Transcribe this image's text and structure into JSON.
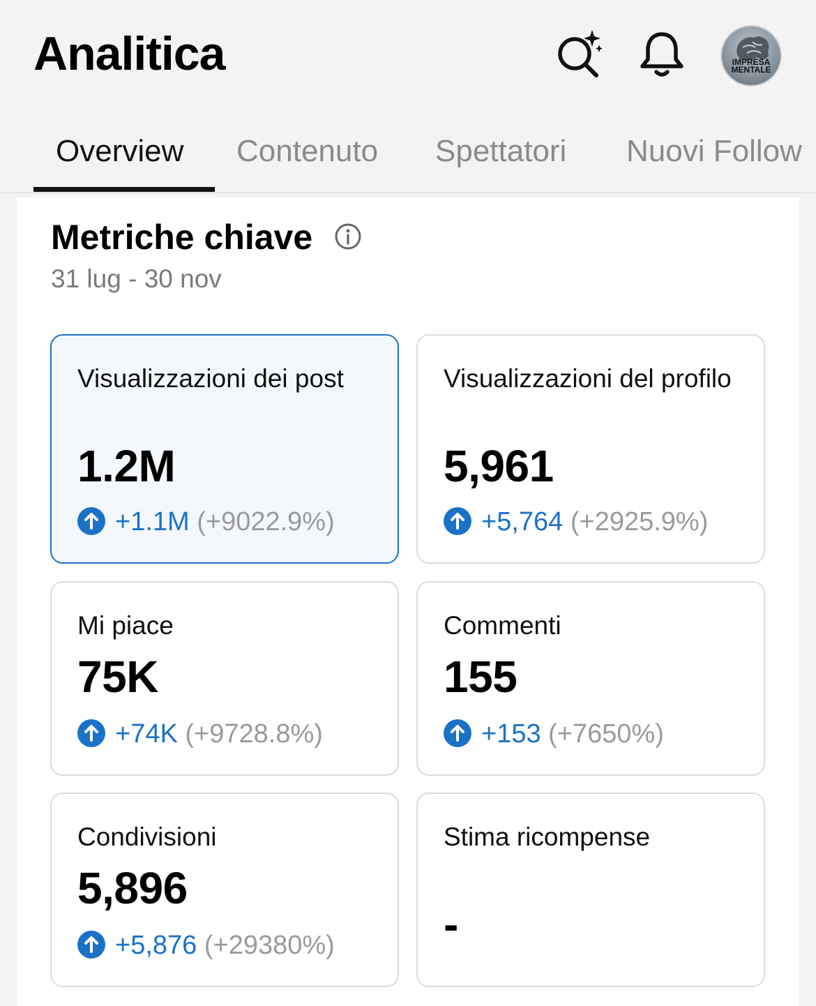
{
  "header": {
    "title": "Analitica",
    "avatar_text_line1": "IMPRESA",
    "avatar_text_line2": "MENTALE"
  },
  "tabs": [
    {
      "label": "Overview",
      "active": true
    },
    {
      "label": "Contenuto",
      "active": false
    },
    {
      "label": "Spettatori",
      "active": false
    },
    {
      "label": "Nuovi Follow",
      "active": false
    }
  ],
  "section": {
    "title": "Metriche chiave",
    "date_range": "31 lug - 30 nov"
  },
  "metrics": [
    {
      "label": "Visualizzazioni dei post",
      "value": "1.2M",
      "delta": "+1.1M",
      "pct": "(+9022.9%)",
      "selected": true
    },
    {
      "label": "Visualizzazioni del profilo",
      "value": "5,961",
      "delta": "+5,764",
      "pct": "(+2925.9%)",
      "selected": false
    },
    {
      "label": "Mi piace",
      "value": "75K",
      "delta": "+74K",
      "pct": "(+9728.8%)",
      "selected": false
    },
    {
      "label": "Commenti",
      "value": "155",
      "delta": "+153",
      "pct": "(+7650%)",
      "selected": false
    },
    {
      "label": "Condivisioni",
      "value": "5,896",
      "delta": "+5,876",
      "pct": "(+29380%)",
      "selected": false
    },
    {
      "label": "Stima ricompense",
      "value": "-",
      "delta": "",
      "pct": "",
      "selected": false
    }
  ],
  "colors": {
    "accent": "#1a72c7",
    "muted": "#9a9a9a"
  },
  "icons": [
    "ai-search-icon",
    "bell-icon",
    "info-icon",
    "arrow-up-circle-icon"
  ]
}
